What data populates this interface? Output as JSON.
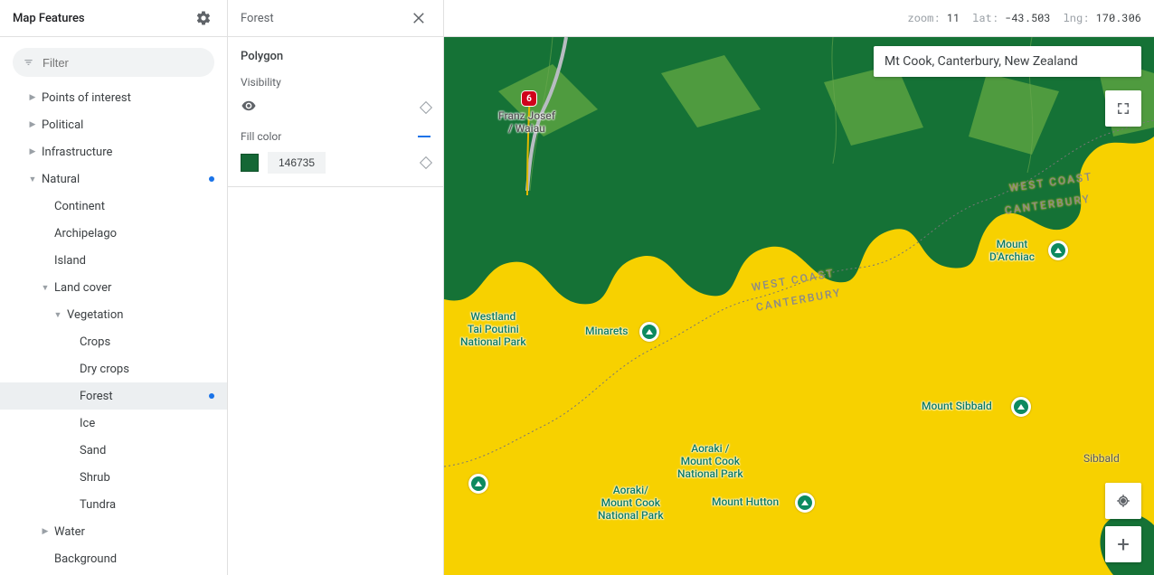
{
  "sidebar": {
    "title": "Map Features",
    "filter_placeholder": "Filter",
    "tree": [
      {
        "label": "Points of interest",
        "indent": 1,
        "arrow": "right"
      },
      {
        "label": "Political",
        "indent": 1,
        "arrow": "right"
      },
      {
        "label": "Infrastructure",
        "indent": 1,
        "arrow": "right"
      },
      {
        "label": "Natural",
        "indent": 1,
        "arrow": "down",
        "modified": true
      },
      {
        "label": "Continent",
        "indent": 2
      },
      {
        "label": "Archipelago",
        "indent": 2
      },
      {
        "label": "Island",
        "indent": 2
      },
      {
        "label": "Land cover",
        "indent": 2,
        "arrow": "down"
      },
      {
        "label": "Vegetation",
        "indent": 3,
        "arrow": "down"
      },
      {
        "label": "Crops",
        "indent": 4
      },
      {
        "label": "Dry crops",
        "indent": 4
      },
      {
        "label": "Forest",
        "indent": 4,
        "modified": true,
        "selected": true
      },
      {
        "label": "Ice",
        "indent": 4
      },
      {
        "label": "Sand",
        "indent": 4
      },
      {
        "label": "Shrub",
        "indent": 4
      },
      {
        "label": "Tundra",
        "indent": 4
      },
      {
        "label": "Water",
        "indent": 2,
        "arrow": "right"
      },
      {
        "label": "Background",
        "indent": 2
      }
    ]
  },
  "panel": {
    "title": "Forest",
    "section_title": "Polygon",
    "visibility_label": "Visibility",
    "fill_label": "Fill color",
    "fill_hex": "146735",
    "fill_color": "#146735"
  },
  "map": {
    "zoom_label": "zoom:",
    "zoom": "11",
    "lat_label": "lat:",
    "lat": "-43.503",
    "lng_label": "lng:",
    "lng": "170.306",
    "search_value": "Mt Cook, Canterbury, New Zealand",
    "highway_shield": "6",
    "town_label": "Franz Josef\n/ Waiau",
    "region_wc": "WEST COAST",
    "region_cb": "CANTERBURY",
    "city_sibbald": "Sibbald",
    "poi": {
      "westland": "Westland\nTai Poutini\nNational Park",
      "minarets": "Minarets",
      "aoraki1": "Aoraki /\nMount Cook\nNational Park",
      "aoraki2": "Aoraki/\nMount Cook\nNational Park",
      "hutton": "Mount Hutton",
      "sibbald": "Mount Sibbald",
      "darchiac": "Mount\nD'Archiac"
    }
  }
}
